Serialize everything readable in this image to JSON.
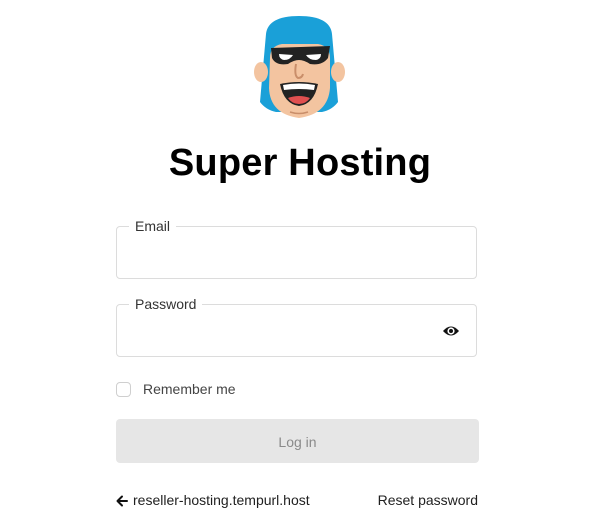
{
  "brand": {
    "title": "Super Hosting",
    "logo_icon": "superhero-mascot-icon",
    "colors": {
      "hood": "#1aa0d8",
      "skin": "#f3c4a0",
      "mask": "#222222"
    }
  },
  "form": {
    "email": {
      "label": "Email",
      "value": ""
    },
    "password": {
      "label": "Password",
      "value": "",
      "toggle_icon": "eye-icon"
    },
    "remember": {
      "label": "Remember me",
      "checked": false
    },
    "submit": {
      "label": "Log in",
      "background": "#e6e6e6",
      "text_color": "#8a8a8a"
    }
  },
  "footer": {
    "back_icon": "arrow-left-icon",
    "back_link": "reseller-hosting.tempurl.host",
    "reset_link": "Reset password"
  }
}
